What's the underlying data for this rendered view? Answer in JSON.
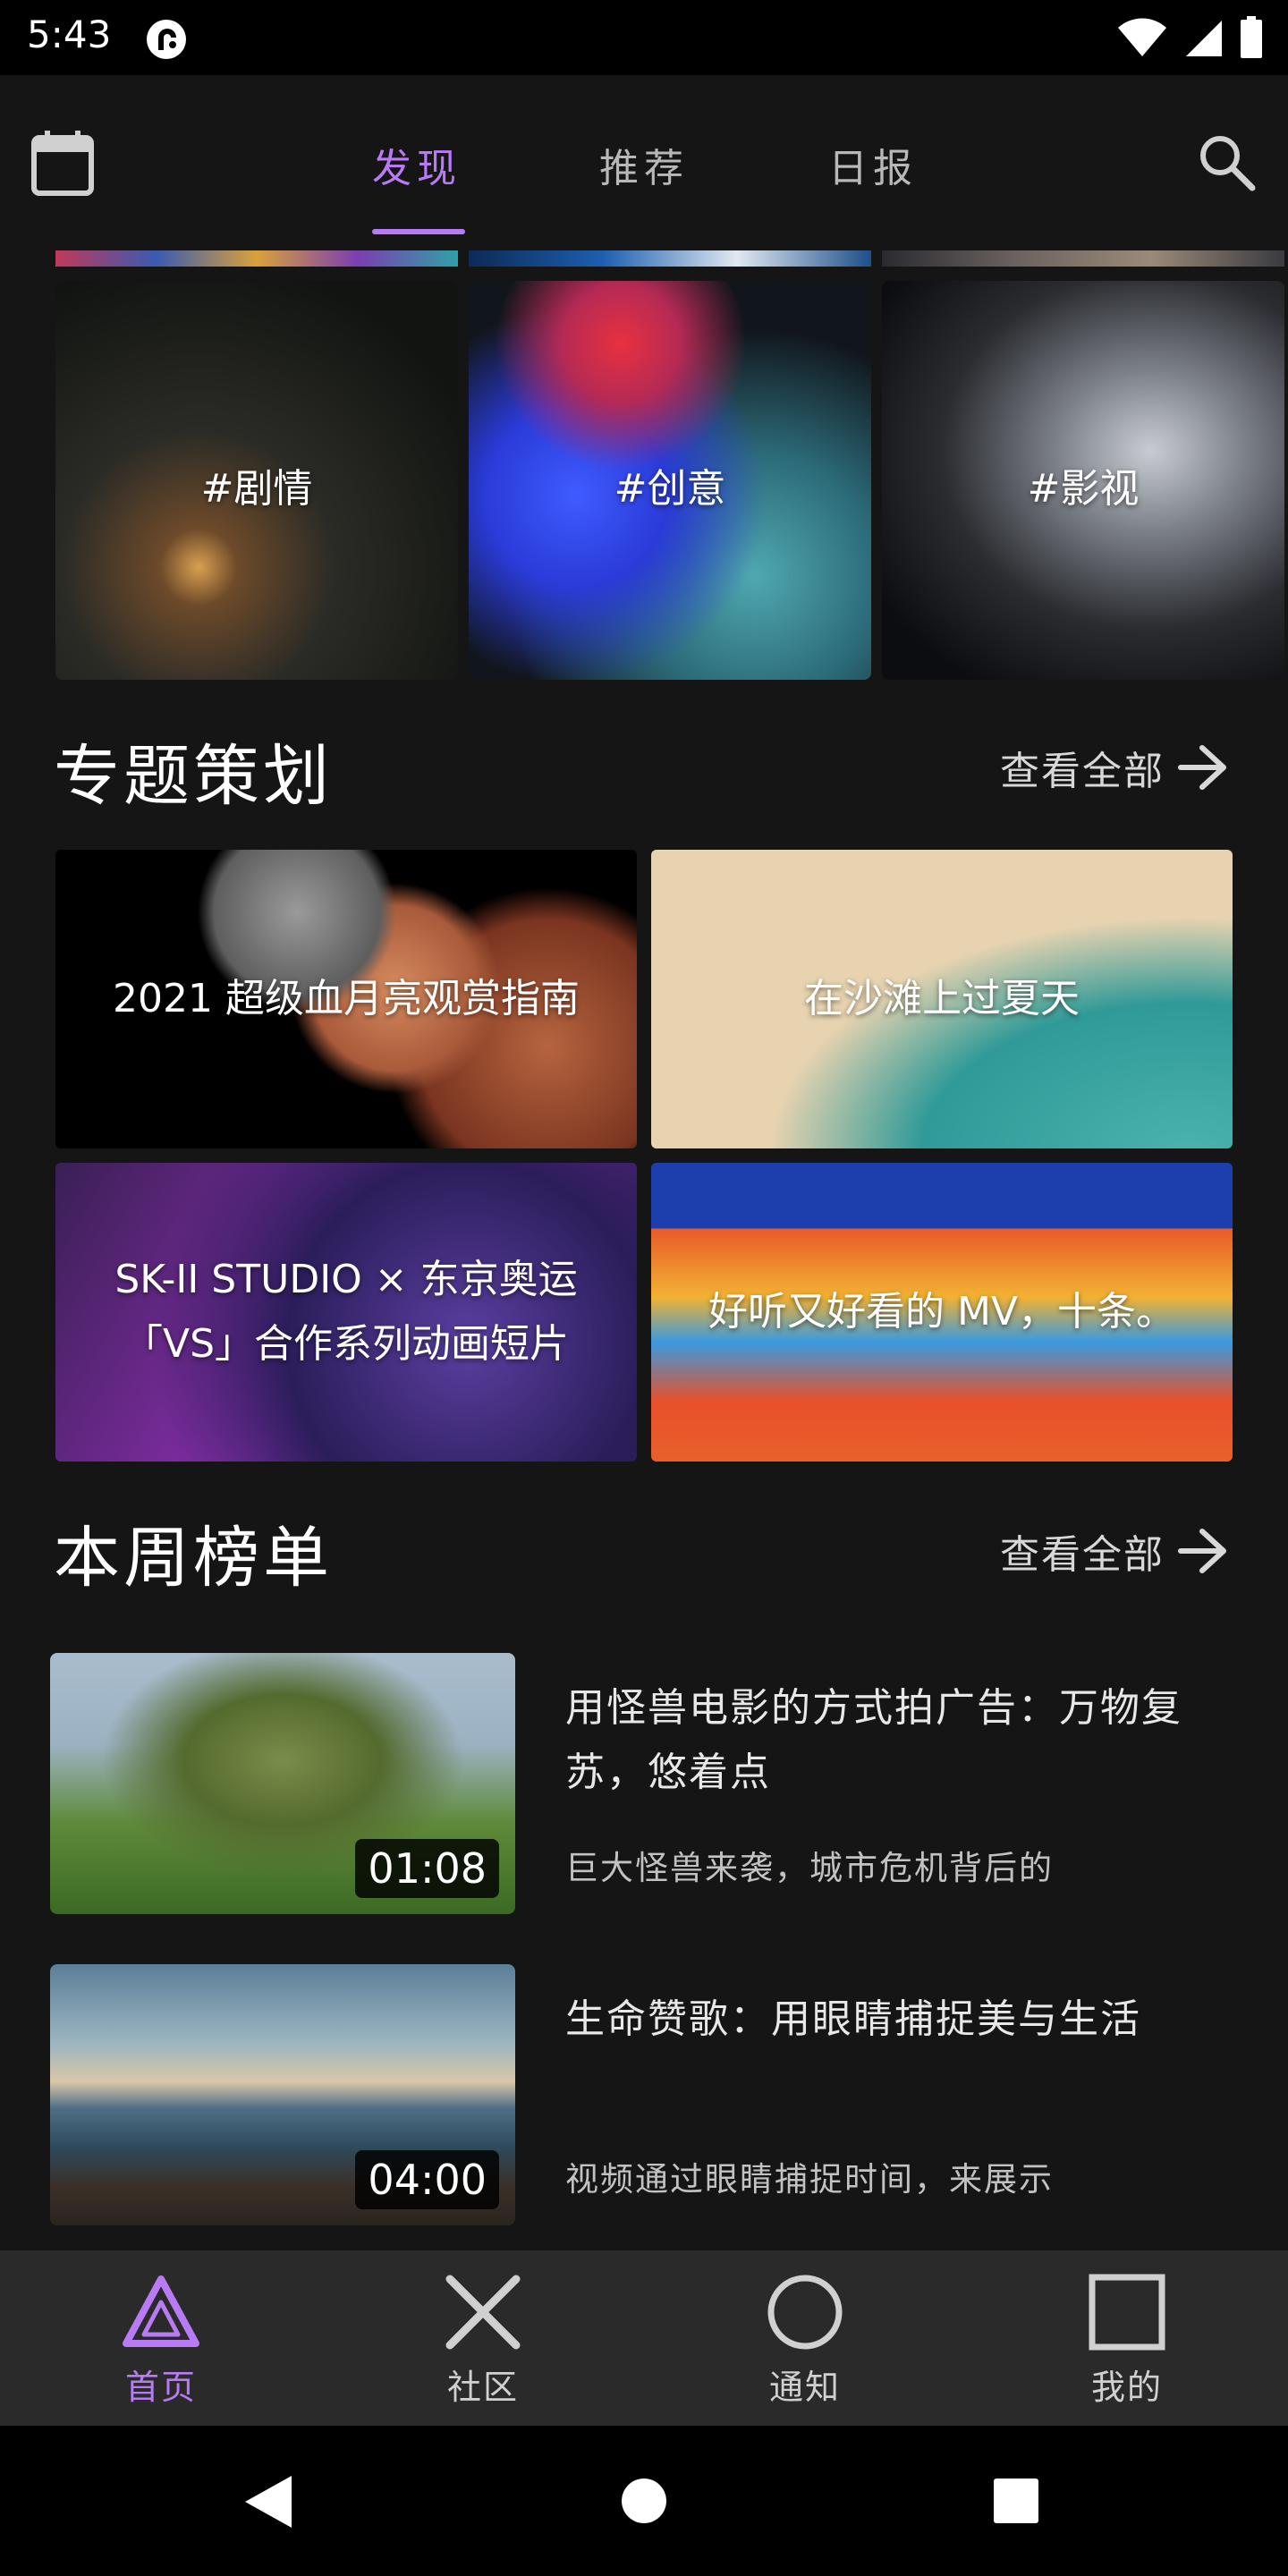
{
  "status_bar": {
    "time": "5:43"
  },
  "top_bar": {
    "tabs": [
      {
        "label": "发现",
        "active": true
      },
      {
        "label": "推荐",
        "active": false
      },
      {
        "label": "日报",
        "active": false
      }
    ]
  },
  "categories": [
    {
      "label": "#剧情"
    },
    {
      "label": "#创意"
    },
    {
      "label": "#影视"
    }
  ],
  "topics_section": {
    "title": "专题策划",
    "view_all": "查看全部",
    "cards": [
      {
        "label": "2021 超级血月亮观赏指南"
      },
      {
        "label": "在沙滩上过夏天"
      },
      {
        "label": "SK-II STUDIO × 东京奥运「VS」合作系列动画短片"
      },
      {
        "label": "好听又好看的 MV，十条。"
      }
    ]
  },
  "weekly_section": {
    "title": "本周榜单",
    "view_all": "查看全部",
    "items": [
      {
        "title": "用怪兽电影的方式拍广告：万物复苏，悠着点",
        "description": "巨大怪兽来袭，城市危机背后的",
        "duration": "01:08"
      },
      {
        "title": "生命赞歌：用眼睛捕捉美与生活",
        "description": "视频通过眼睛捕捉时间，来展示",
        "duration": "04:00"
      }
    ]
  },
  "bottom_nav": {
    "items": [
      {
        "label": "首页",
        "icon": "triangle-icon",
        "active": true
      },
      {
        "label": "社区",
        "icon": "cross-icon",
        "active": false
      },
      {
        "label": "通知",
        "icon": "circle-icon",
        "active": false
      },
      {
        "label": "我的",
        "icon": "square-icon",
        "active": false
      }
    ]
  },
  "colors": {
    "accent": "#b87bf5",
    "background": "#151515",
    "bottom_nav_bg": "#2a2a2a"
  }
}
